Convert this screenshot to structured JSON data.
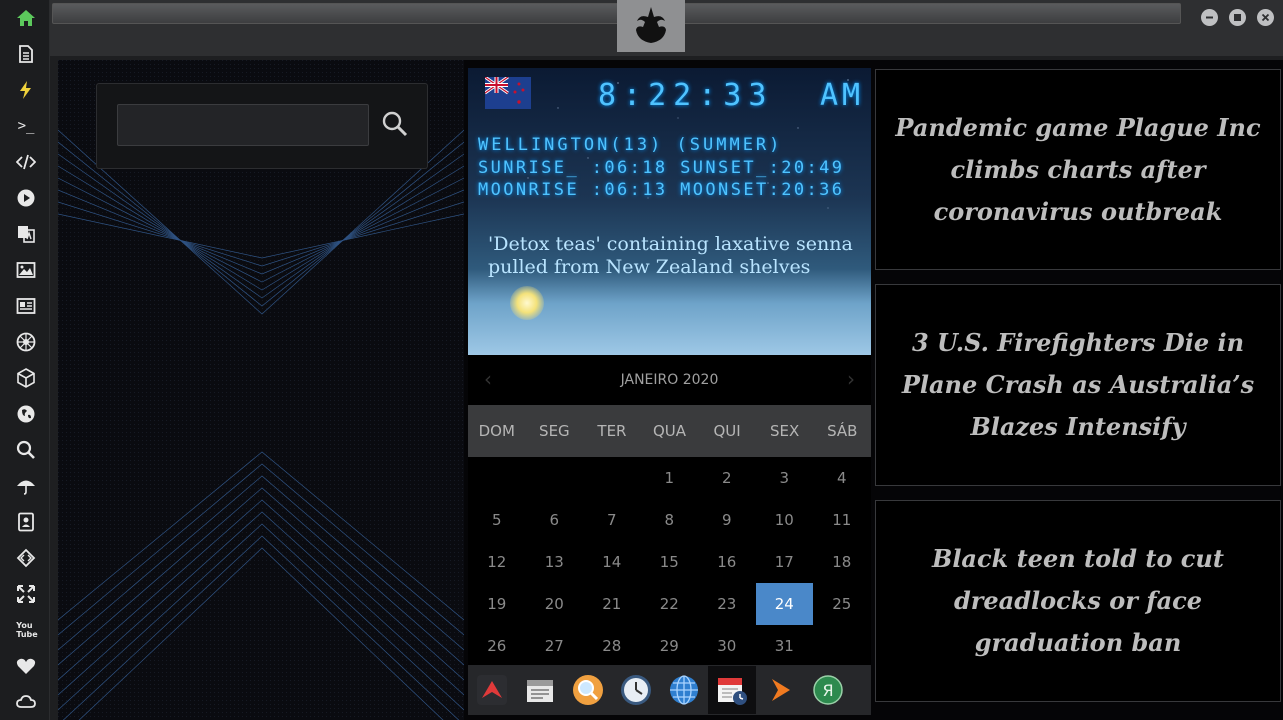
{
  "sidebar": {
    "icons": [
      "home-icon",
      "document-icon",
      "lightning-icon",
      "terminal-icon",
      "code-icon",
      "play-icon",
      "translate-icon",
      "image-icon",
      "newspaper-icon",
      "rebel-icon",
      "cube-icon",
      "globe-icon",
      "search-icon",
      "umbrella-icon",
      "contacts-icon",
      "diamond-code-icon",
      "expand-icon",
      "youtube-icon",
      "heart-icon",
      "cloud-icon"
    ],
    "youtube_label": "You Tube",
    "terminal_label": ">_"
  },
  "window": {
    "emblem": "rebel-alliance-icon",
    "controls": [
      "minimize-icon",
      "maximize-icon",
      "close-icon"
    ]
  },
  "search": {
    "value": "",
    "placeholder": ""
  },
  "clock": {
    "time": "8:22:33",
    "ampm": "AM",
    "location": "WELLINGTON(13) (SUMMER)",
    "sun_line": "SUNRISE_ :06:18 SUNSET_:20:49",
    "moon_line": "MOONRISE :06:13 MOONSET:20:36",
    "flag": "new-zealand-flag"
  },
  "weather_headline": "'Detox teas' containing laxative senna pulled from New Zealand shelves",
  "calendar": {
    "month_label": "JANEIRO 2020",
    "weekdays": [
      "DOM",
      "SEG",
      "TER",
      "QUA",
      "QUI",
      "SEX",
      "SÁB"
    ],
    "weeks": [
      [
        "",
        "",
        "",
        "1",
        "2",
        "3",
        "4"
      ],
      [
        "5",
        "6",
        "7",
        "8",
        "9",
        "10",
        "11"
      ],
      [
        "12",
        "13",
        "14",
        "15",
        "16",
        "17",
        "18"
      ],
      [
        "19",
        "20",
        "21",
        "22",
        "23",
        "24",
        "25"
      ],
      [
        "26",
        "27",
        "28",
        "29",
        "30",
        "31",
        ""
      ]
    ],
    "today": "24"
  },
  "dock": [
    "arrow-app-icon",
    "calendar-doc-icon",
    "magnifier-app-icon",
    "clock-app-icon",
    "globe-app-icon",
    "calendar-clock-app-icon",
    "play-arrow-app-icon",
    "yandex-app-icon"
  ],
  "dock_yandex_letter": "Я",
  "news": [
    "Pandemic game Plague Inc climbs charts after coronavirus outbreak",
    "3 U.S. Firefighters Die in Plane Crash as Australia’s Blazes Intensify",
    "Black teen told to cut dreadlocks or face graduation ban"
  ],
  "colors": {
    "accent": "#4a88c9",
    "lcd": "#4fc3ff",
    "home": "#5cc95c",
    "lightning": "#f0d23c"
  }
}
